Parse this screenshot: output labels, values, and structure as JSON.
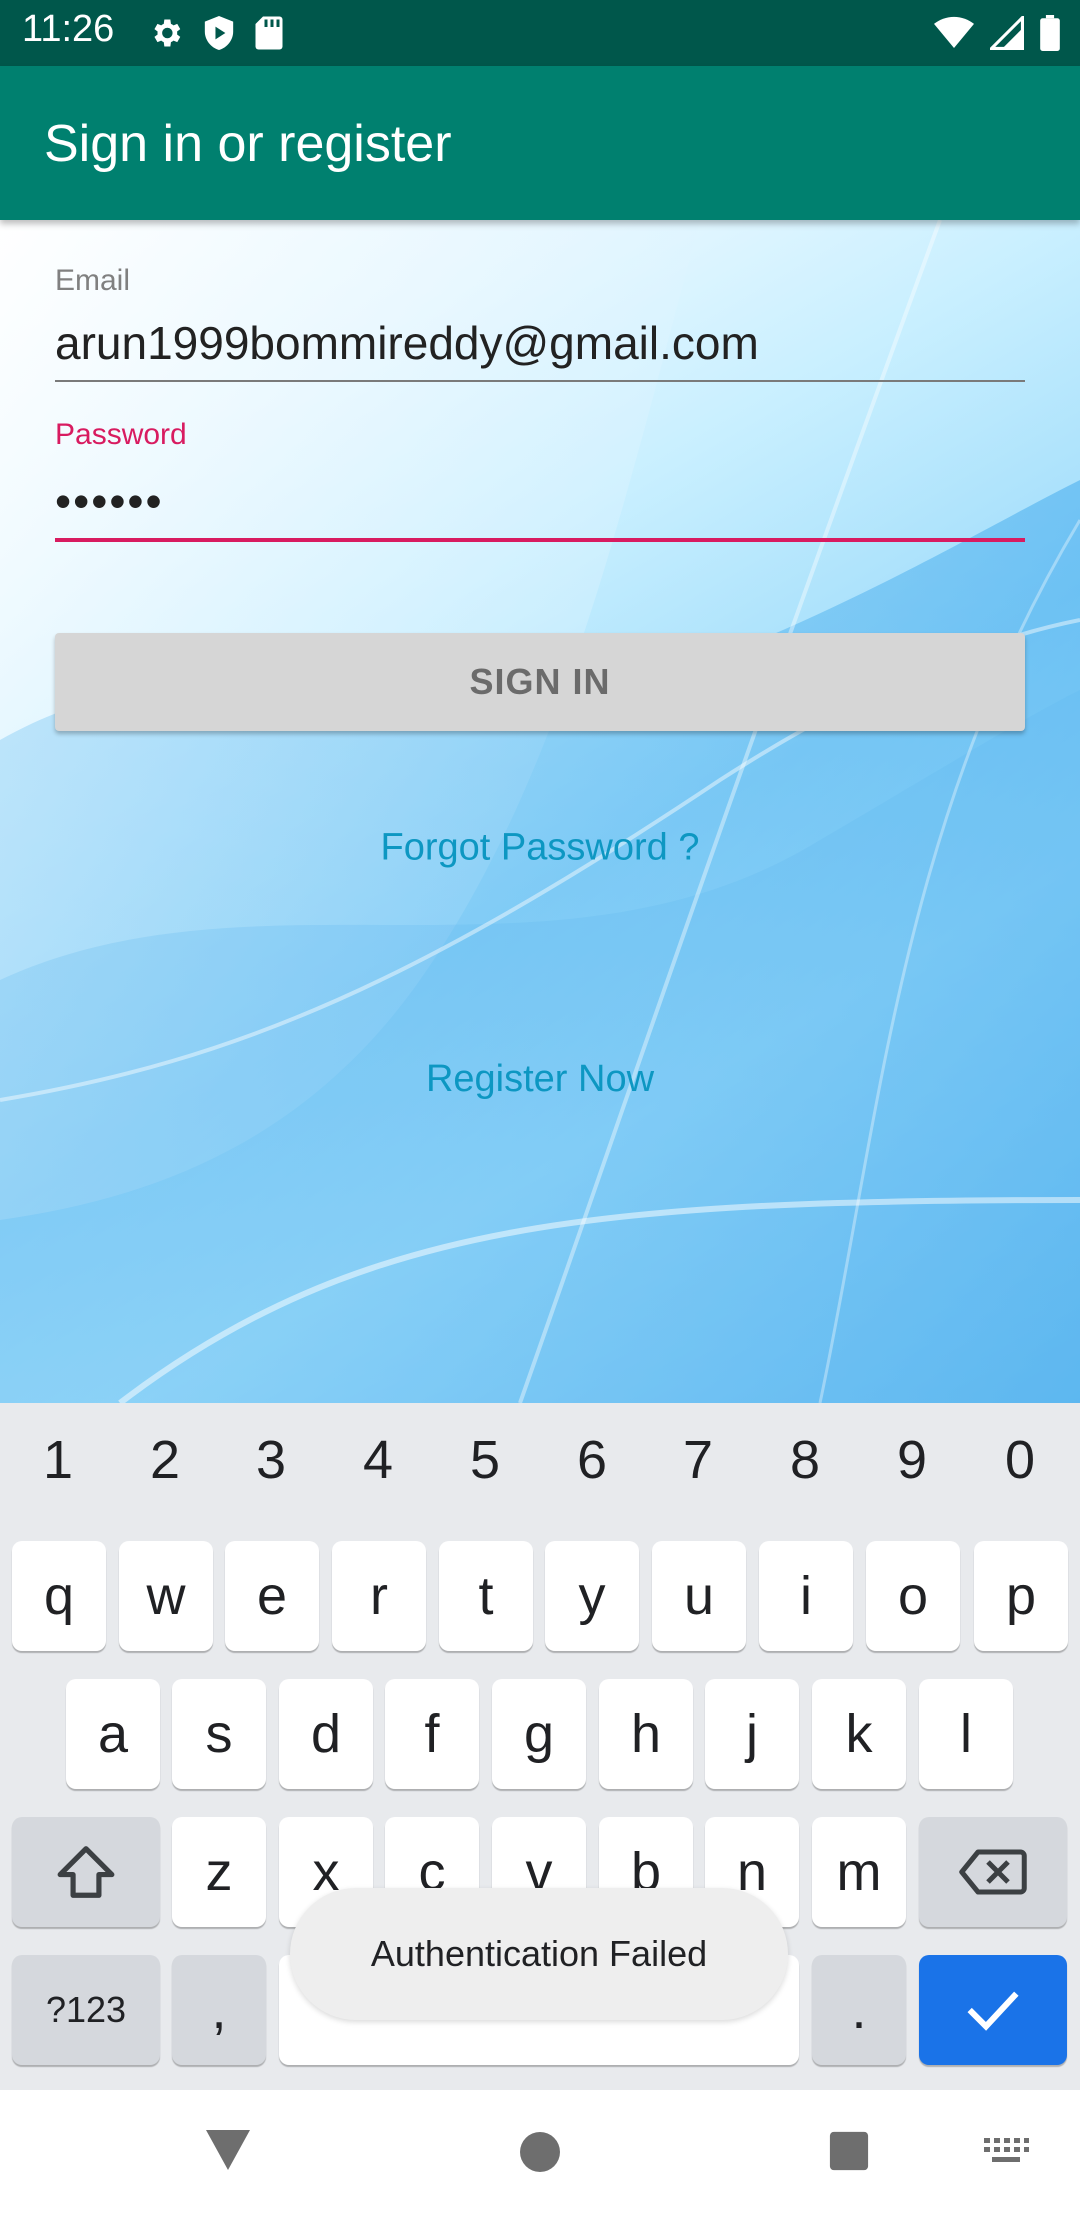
{
  "status_bar": {
    "time": "11:26",
    "left_icons": [
      "gear-icon",
      "shield-play-icon",
      "sd-card-icon"
    ],
    "right_icons": [
      "wifi-icon",
      "cell-signal-icon",
      "battery-icon"
    ]
  },
  "app_bar": {
    "title": "Sign in or register"
  },
  "form": {
    "email_label": "Email",
    "email_value": "arun1999bommireddy@gmail.com",
    "password_label": "Password",
    "password_value": "••••••",
    "signin_label": "SIGN IN",
    "forgot_link": "Forgot Password ?",
    "register_link": "Register Now"
  },
  "keyboard": {
    "numbers": [
      "1",
      "2",
      "3",
      "4",
      "5",
      "6",
      "7",
      "8",
      "9",
      "0"
    ],
    "row1": [
      "q",
      "w",
      "e",
      "r",
      "t",
      "y",
      "u",
      "i",
      "o",
      "p"
    ],
    "row2": [
      "a",
      "s",
      "d",
      "f",
      "g",
      "h",
      "j",
      "k",
      "l"
    ],
    "row3": [
      "z",
      "x",
      "c",
      "v",
      "b",
      "n",
      "m"
    ],
    "symbols_label": "?123",
    "comma": ",",
    "period": "."
  },
  "toast": {
    "message": "Authentication Failed"
  },
  "colors": {
    "status_bar": "#00574b",
    "app_bar": "#00806f",
    "accent": "#d81b60",
    "link": "#0d97c2",
    "keyboard_bg": "#e8eaed",
    "enter_key": "#1a73e8"
  }
}
